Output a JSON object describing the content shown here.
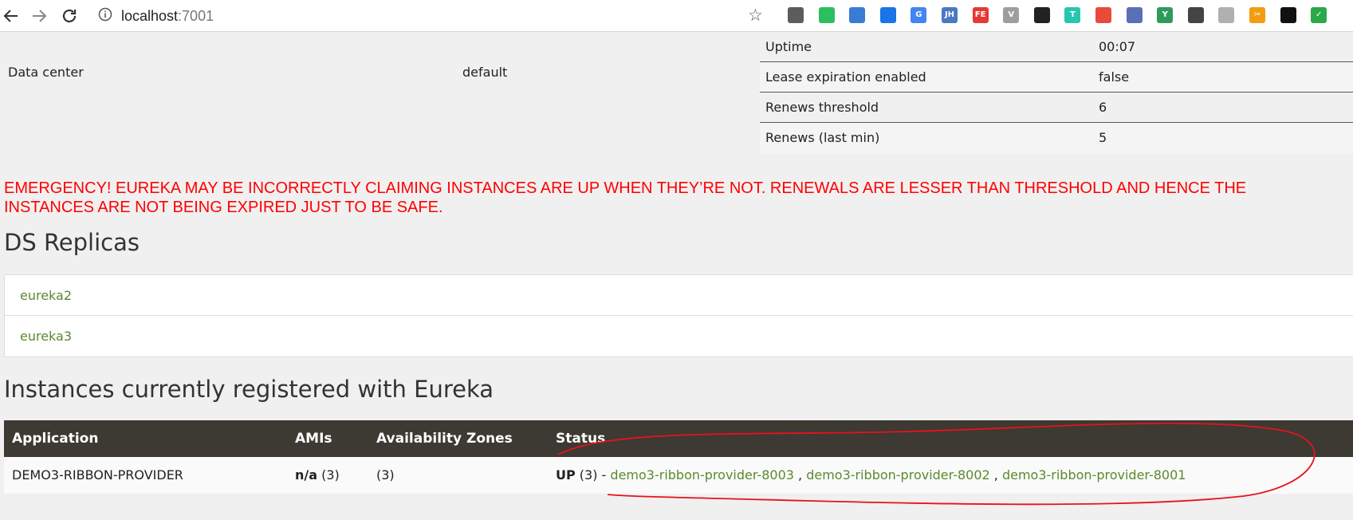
{
  "browser": {
    "url_host": "localhost",
    "url_port": ":7001",
    "icons": [
      "back-arrow-icon",
      "forward-arrow-icon",
      "reload-icon",
      "info-icon",
      "star-icon"
    ],
    "extensions": [
      {
        "name": "ext-1-icon",
        "label": "",
        "color": "#5c5c5c"
      },
      {
        "name": "evernote-icon",
        "label": "",
        "color": "#2dbe60"
      },
      {
        "name": "ext-globe-icon",
        "label": "",
        "color": "#3a7bd5"
      },
      {
        "name": "ext-download-icon",
        "label": "",
        "color": "#1a73e8"
      },
      {
        "name": "google-translate-icon",
        "label": "G",
        "color": "#4285f4"
      },
      {
        "name": "ext-jh-icon",
        "label": "JH",
        "color": "#4a78c2"
      },
      {
        "name": "ext-fe-icon",
        "label": "FE",
        "color": "#e53935"
      },
      {
        "name": "ext-v-icon",
        "label": "V",
        "color": "#9e9e9e"
      },
      {
        "name": "ext-mask-icon",
        "label": "",
        "color": "#222222"
      },
      {
        "name": "ext-t-icon",
        "label": "T",
        "color": "#26c6b0"
      },
      {
        "name": "ext-cube-icon",
        "label": "",
        "color": "#e84a3c"
      },
      {
        "name": "ext-window-icon",
        "label": "",
        "color": "#5b6fb5"
      },
      {
        "name": "ext-y-icon",
        "label": "Y",
        "color": "#2e9b5c"
      },
      {
        "name": "qr-code-icon",
        "label": "",
        "color": "#444444"
      },
      {
        "name": "ext-gray-icon",
        "label": "",
        "color": "#b0b0b0"
      },
      {
        "name": "scissors-icon",
        "label": "✂",
        "color": "#f39c12"
      },
      {
        "name": "ext-square-icon",
        "label": "",
        "color": "#111111"
      },
      {
        "name": "ext-check-icon",
        "label": "✓",
        "color": "#2aa84a"
      }
    ]
  },
  "general_info": {
    "data_center_label": "Data center",
    "data_center_value": "default",
    "rows": [
      {
        "key": "Uptime",
        "value": "00:07"
      },
      {
        "key": "Lease expiration enabled",
        "value": "false"
      },
      {
        "key": "Renews threshold",
        "value": "6"
      },
      {
        "key": "Renews (last min)",
        "value": "5"
      }
    ]
  },
  "emergency": {
    "line1": "EMERGENCY! EUREKA MAY BE INCORRECTLY CLAIMING INSTANCES ARE UP WHEN THEY’RE NOT. RENEWALS ARE LESSER THAN THRESHOLD AND HENCE THE",
    "line2": "INSTANCES ARE NOT BEING EXPIRED JUST TO BE SAFE."
  },
  "replicas": {
    "title": "DS Replicas",
    "items": [
      "eureka2",
      "eureka3"
    ]
  },
  "instances": {
    "title": "Instances currently registered with Eureka",
    "headers": [
      "Application",
      "AMIs",
      "Availability Zones",
      "Status"
    ],
    "rows": [
      {
        "application": "DEMO3-RIBBON-PROVIDER",
        "amis_bold": "n/a",
        "amis_count": " (3)",
        "zones": "(3)",
        "status_bold": "UP",
        "status_count": " (3) - ",
        "links": [
          "demo3-ribbon-provider-8003",
          "demo3-ribbon-provider-8002",
          "demo3-ribbon-provider-8001"
        ],
        "separator": " , "
      }
    ]
  },
  "colors": {
    "emergency": "#ff0000",
    "link": "#5a8a2e",
    "table_header": "#3d3933",
    "annotation": "#e8121c"
  }
}
